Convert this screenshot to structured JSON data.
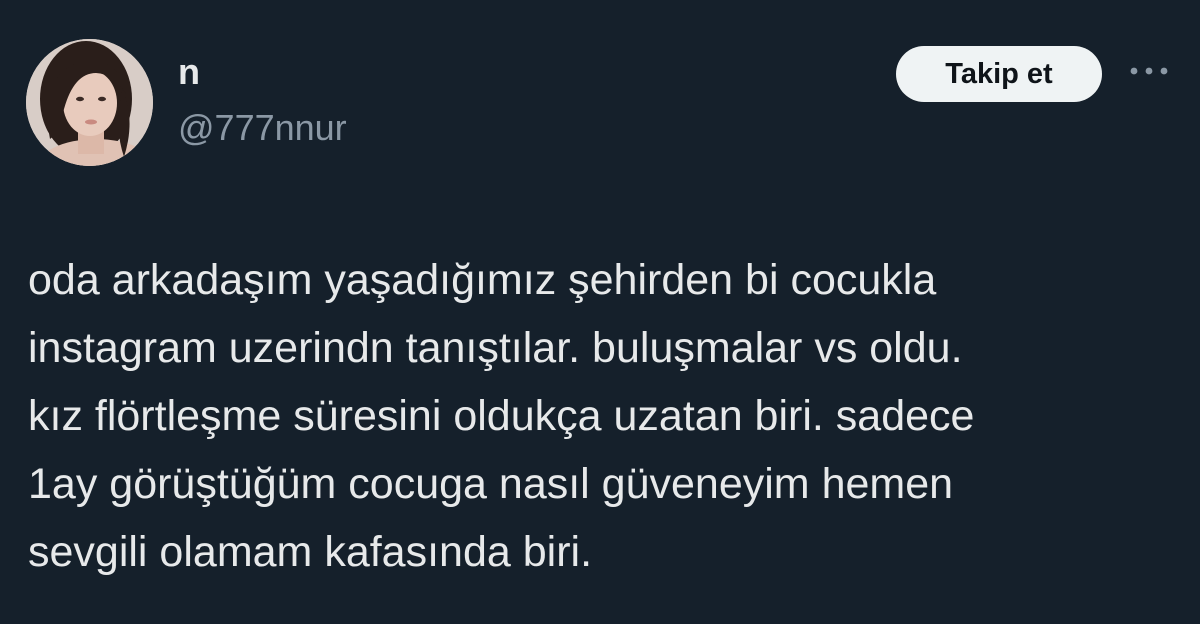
{
  "author": {
    "display_name": "n",
    "handle": "@777nnur"
  },
  "actions": {
    "follow_label": "Takip et",
    "more_icon": "more-horizontal-icon"
  },
  "tweet": {
    "text": "oda arkadaşım yaşadığımız şehirden bi cocukla\ninstagram uzerindn tanıştılar. buluşmalar vs oldu.\nkız flörtleşme süresini oldukça uzatan biri. sadece\n1ay görüştüğüm cocuga nasıl güveneyim hemen\nsevgili olamam kafasında biri."
  },
  "colors": {
    "background": "#15202b",
    "text_primary": "#e7e9ea",
    "text_secondary": "#8b98a5",
    "button_bg": "#eff3f4",
    "button_text": "#0f1419"
  }
}
